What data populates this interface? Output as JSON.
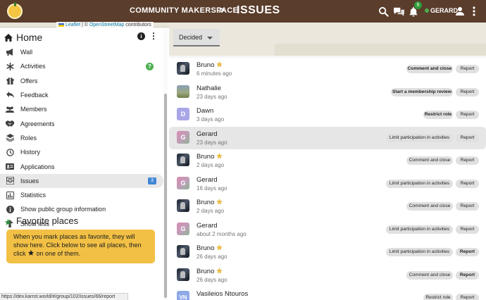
{
  "topbar": {
    "group_name": "COMMUNITY MAKERSPACE",
    "separator": ">",
    "page_title": "ISSUES",
    "notification_count": "9",
    "user_name": "GERARD",
    "icons": [
      "logo-icon",
      "search-icon",
      "chat-icon",
      "bell-icon",
      "person-icon",
      "more-vert-icon"
    ]
  },
  "map": {
    "attrib_leaflet": "Leaflet",
    "attrib_sep": " | © ",
    "attrib_osm": "OpenStreetMap",
    "attrib_rest": " contributors"
  },
  "sidebar": {
    "home_title": "Home",
    "items": [
      {
        "label": "Wall",
        "icon": "megaphone-icon"
      },
      {
        "label": "Activities",
        "icon": "asterisk-icon",
        "help": "?"
      },
      {
        "label": "Offers",
        "icon": "gift-icon"
      },
      {
        "label": "Feedback",
        "icon": "reply-icon"
      },
      {
        "label": "Members",
        "icon": "people-icon"
      },
      {
        "label": "Agreements",
        "icon": "handshake-icon"
      },
      {
        "label": "Roles",
        "icon": "layers-icon"
      },
      {
        "label": "History",
        "icon": "history-icon"
      },
      {
        "label": "Applications",
        "icon": "id-card-icon"
      },
      {
        "label": "Issues",
        "icon": "inbox-icon",
        "badge": "3",
        "active": true
      },
      {
        "label": "Statistics",
        "icon": "bar-chart-icon"
      },
      {
        "label": "Show public group information",
        "icon": "info-icon"
      },
      {
        "label": "Show less",
        "icon": "arrow-up-icon"
      }
    ],
    "favorites_title": "Favorite places",
    "favorites_text_1": "When you mark places as favorite, they will show here. Click below to see all places, then click",
    "favorites_text_2": "on one of them."
  },
  "statusbar": {
    "url": "https://dev.karrot.world/#/group/102/issues/66/report"
  },
  "main": {
    "filter_value": "Decided",
    "report_label": "Report",
    "rows": [
      {
        "name": "Bruno",
        "star": true,
        "time": "6 minutes ago",
        "avatar": "photo",
        "action": "Comment and close",
        "action_bold": true,
        "report_bold": false
      },
      {
        "name": "Nathalie",
        "star": false,
        "time": "23 days ago",
        "avatar": "nathalie",
        "action": "Start a membership review",
        "action_bold": true,
        "report_bold": false
      },
      {
        "name": "Dawn",
        "star": false,
        "time": "3 days ago",
        "avatar": "letter",
        "initial": "D",
        "action": "Restrict role",
        "action_bold": true,
        "report_bold": false
      },
      {
        "name": "Gerard",
        "star": false,
        "time": "23 days ago",
        "avatar": "gradient",
        "initial": "G",
        "action": "Limit participation in activities",
        "action_bold": false,
        "report_bold": false,
        "highlight": true
      },
      {
        "name": "Bruno",
        "star": true,
        "time": "2 days ago",
        "avatar": "photo",
        "action": "Comment and close",
        "action_bold": false,
        "report_bold": false
      },
      {
        "name": "Gerard",
        "star": false,
        "time": "16 days ago",
        "avatar": "gradient",
        "initial": "G",
        "action": "Limit participation in activities",
        "action_bold": false,
        "report_bold": false
      },
      {
        "name": "Bruno",
        "star": true,
        "time": "2 days ago",
        "avatar": "photo",
        "action": "Comment and close",
        "action_bold": false,
        "report_bold": false
      },
      {
        "name": "Gerard",
        "star": false,
        "time": "about 2 months ago",
        "avatar": "gradient",
        "initial": "G",
        "action": "Limit participation in activities",
        "action_bold": false,
        "report_bold": false
      },
      {
        "name": "Bruno",
        "star": true,
        "time": "26 days ago",
        "avatar": "photo",
        "action": "Limit participation in activities",
        "action_bold": false,
        "report_bold": true
      },
      {
        "name": "Bruno",
        "star": true,
        "time": "26 days ago",
        "avatar": "photo",
        "action": "Comment and close",
        "action_bold": false,
        "report_bold": true
      },
      {
        "name": "Vasileios Ntouros",
        "star": false,
        "time": "",
        "avatar": "vn",
        "initial": "VN",
        "action": "Restrict role",
        "action_bold": false,
        "report_bold": false
      }
    ]
  },
  "colors": {
    "topbar": "#5a3d2b",
    "favorites_box": "#f2c044",
    "badge": "#3f87d6",
    "online": "#4caf50",
    "star": "#f2c044"
  }
}
